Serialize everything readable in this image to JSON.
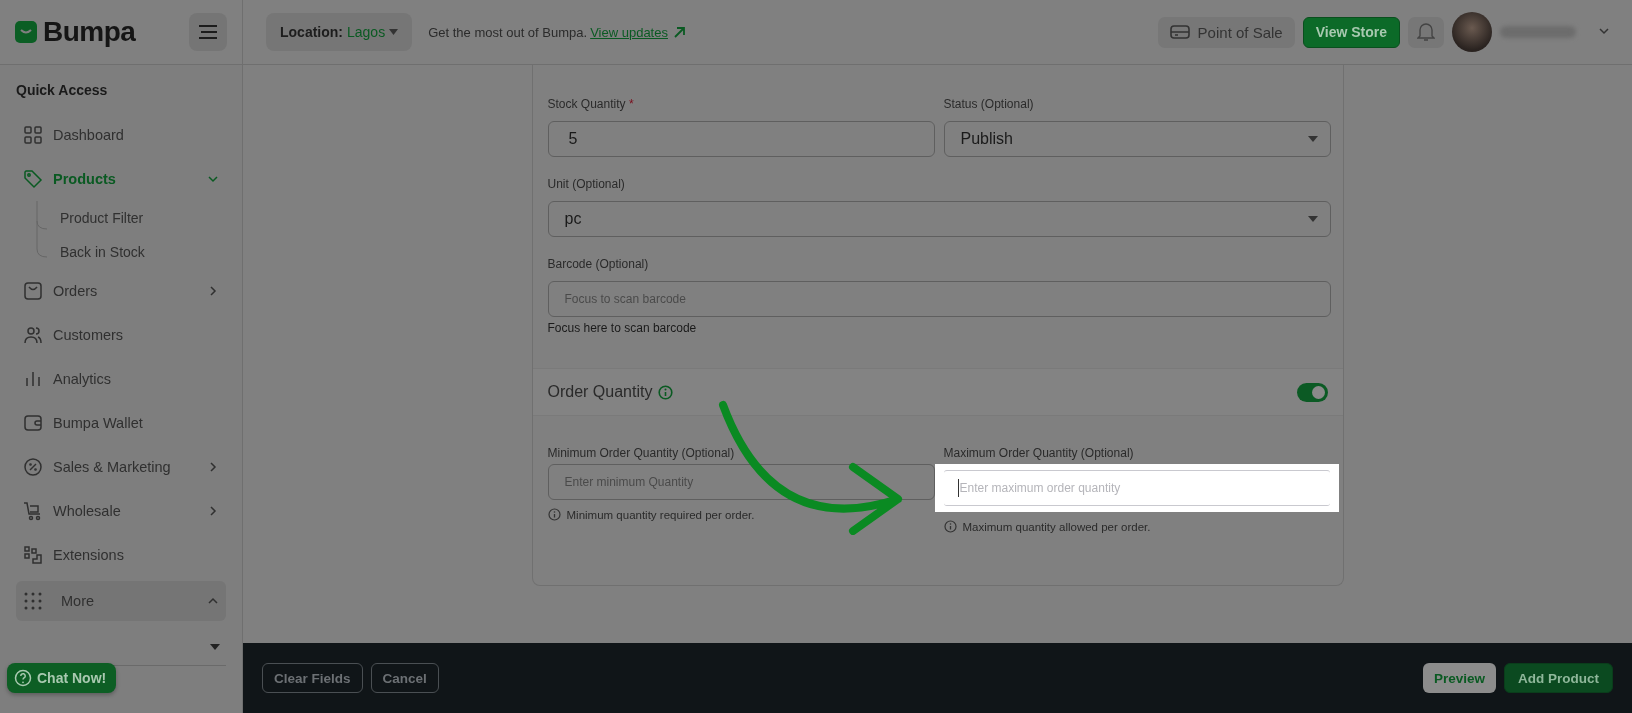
{
  "brand": {
    "name": "Bumpa"
  },
  "topbar": {
    "location_label": "Location:",
    "location_value": "Lagos",
    "promo": "Get the most out of Bumpa.",
    "promo_link": "View updates",
    "buttons": [
      {
        "label": "Point of Sale",
        "kind": "secondary"
      },
      {
        "label": "View Store",
        "kind": "primary"
      }
    ]
  },
  "sidebar": {
    "heading": "Quick Access",
    "items": [
      {
        "label": "Dashboard",
        "kind": "link",
        "selected": false
      },
      {
        "label": "Products",
        "kind": "group",
        "selected": true,
        "expanded": true,
        "children": [
          {
            "label": "Product Filter",
            "selected": false
          },
          {
            "label": "Back in Stock",
            "selected": false
          }
        ]
      },
      {
        "label": "Orders",
        "kind": "group",
        "selected": false,
        "expanded": false
      },
      {
        "label": "Customers",
        "kind": "link",
        "selected": false
      },
      {
        "label": "Analytics",
        "kind": "link",
        "selected": false
      },
      {
        "label": "Bumpa Wallet",
        "kind": "link",
        "selected": false
      },
      {
        "label": "Sales & Marketing",
        "kind": "group",
        "selected": false,
        "expanded": false
      },
      {
        "label": "Wholesale",
        "kind": "group",
        "selected": false,
        "expanded": false
      },
      {
        "label": "Extensions",
        "kind": "link",
        "selected": false
      },
      {
        "label": "More",
        "kind": "section",
        "selected": false,
        "expanded": true
      }
    ],
    "chat_button": "Chat Now!"
  },
  "form": {
    "fields": [
      {
        "label": "Stock Quantity",
        "required_mark": "*",
        "kind": "input",
        "value": "5"
      },
      {
        "label": "Status (Optional)",
        "kind": "select",
        "value": "Publish"
      },
      {
        "label": "Unit (Optional)",
        "kind": "select",
        "value": "pc"
      },
      {
        "label": "Barcode (Optional)",
        "kind": "input",
        "placeholder": "Focus to scan barcode",
        "helper": "Focus here to scan barcode"
      }
    ],
    "order_quantity": {
      "title": "Order Quantity",
      "on": true,
      "fields": [
        {
          "label": "Minimum Order Quantity (Optional)",
          "placeholder": "Enter minimum Quantity",
          "hint": "Minimum quantity required per order.",
          "highlighted": false
        },
        {
          "label": "Maximum Order Quantity (Optional)",
          "placeholder": "Enter maximum order quantity",
          "hint": "Maximum quantity allowed per order.",
          "highlighted": true
        }
      ]
    }
  },
  "footer": {
    "buttons": [
      {
        "label": "Clear Fields",
        "kind": "outline"
      },
      {
        "label": "Cancel",
        "kind": "outline"
      },
      {
        "label": "Preview",
        "kind": "light"
      },
      {
        "label": "Add Product",
        "kind": "primary"
      }
    ]
  }
}
